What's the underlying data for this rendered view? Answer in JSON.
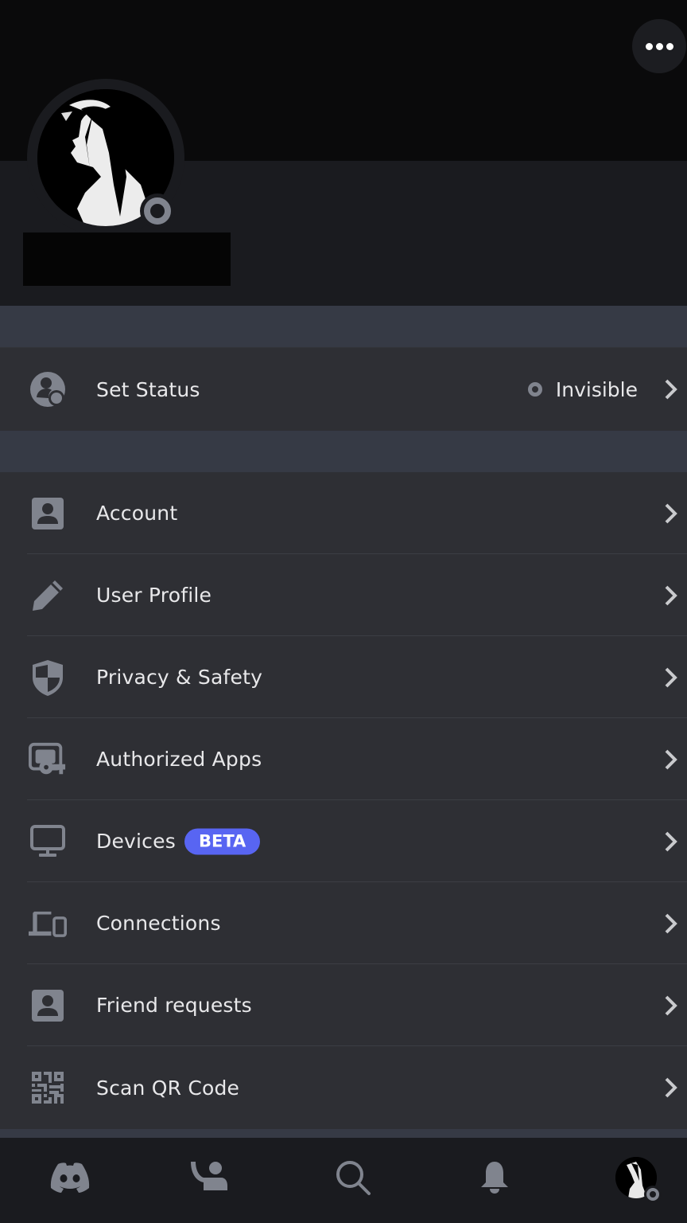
{
  "header": {
    "more_button": "more-options",
    "avatar_status": "invisible"
  },
  "status_row": {
    "label": "Set Status",
    "value": "Invisible",
    "icon": "set-status-icon"
  },
  "settings": {
    "items": [
      {
        "label": "Account",
        "icon": "account-icon"
      },
      {
        "label": "User Profile",
        "icon": "pencil-icon"
      },
      {
        "label": "Privacy & Safety",
        "icon": "shield-icon"
      },
      {
        "label": "Authorized Apps",
        "icon": "key-icon"
      },
      {
        "label": "Devices",
        "icon": "monitor-icon",
        "badge": "BETA"
      },
      {
        "label": "Connections",
        "icon": "devices-icon"
      },
      {
        "label": "Friend requests",
        "icon": "friend-icon"
      },
      {
        "label": "Scan QR Code",
        "icon": "qr-code-icon"
      }
    ]
  },
  "tabbar": {
    "tabs": [
      {
        "name": "home",
        "icon": "discord-icon"
      },
      {
        "name": "friends",
        "icon": "friends-wave-icon"
      },
      {
        "name": "search",
        "icon": "search-icon"
      },
      {
        "name": "notifications",
        "icon": "bell-icon"
      },
      {
        "name": "you",
        "icon": "avatar"
      }
    ]
  },
  "colors": {
    "accent": "#5865f2",
    "status_invisible": "#80848e",
    "row_bg": "#2e2f34",
    "section_gap": "#363a45",
    "icon_gray": "#80848e"
  }
}
